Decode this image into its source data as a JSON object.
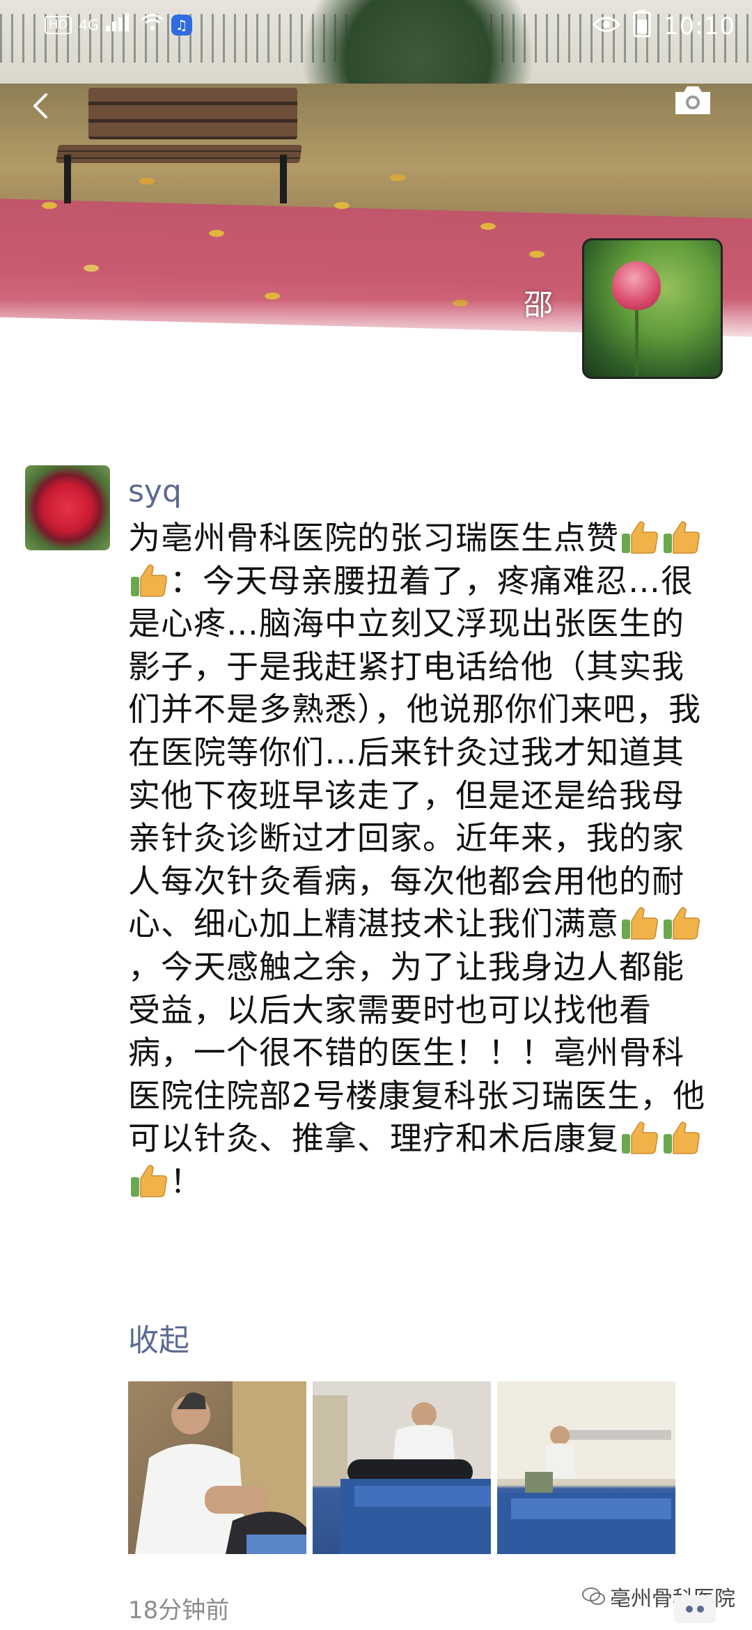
{
  "status_bar": {
    "hd_badge": "HD",
    "signal_label": "4G",
    "time": "10:10",
    "icons": [
      "eye-icon",
      "music-app-icon",
      "wifi-icon",
      "signal-icon",
      "battery-icon"
    ]
  },
  "header": {
    "back_icon": "chevron-left-icon",
    "camera_icon": "camera-icon",
    "owner_name": "邵"
  },
  "post": {
    "author": "syq",
    "text_segments": [
      {
        "type": "text",
        "value": "为亳州骨科医院的张习瑞医生点赞"
      },
      {
        "type": "thumb"
      },
      {
        "type": "thumb"
      },
      {
        "type": "thumb"
      },
      {
        "type": "text",
        "value": "：今天母亲腰扭着了，疼痛难忍…很是心疼…脑海中立刻又浮现出张医生的影子，于是我赶紧打电话给他（其实我们并不是多熟悉），他说那你们来吧，我在医院等你们…后来针灸过我才知道其实他下夜班早该走了，但是还是给我母亲针灸诊断过才回家。近年来，我的家人每次针灸看病，每次他都会用他的耐心、细心加上精湛技术让我们满意"
      },
      {
        "type": "thumb"
      },
      {
        "type": "thumb"
      },
      {
        "type": "text",
        "value": "，今天感触之余，为了让我身边人都能受益，以后大家需要时也可以找他看病，一个很不错的医生！！！亳州骨科医院住院部2号楼康复科张习瑞医生，他可以针灸、推拿、理疗和术后康复"
      },
      {
        "type": "thumb"
      },
      {
        "type": "thumb"
      },
      {
        "type": "thumb"
      },
      {
        "type": "text",
        "value": "！"
      }
    ],
    "collapse_label": "收起",
    "photo_count": 3,
    "time_ago": "18分钟前"
  },
  "watermark": {
    "label": "亳州骨科医院"
  },
  "colors": {
    "link": "#5b6a92",
    "meta": "#8c8c8c"
  }
}
